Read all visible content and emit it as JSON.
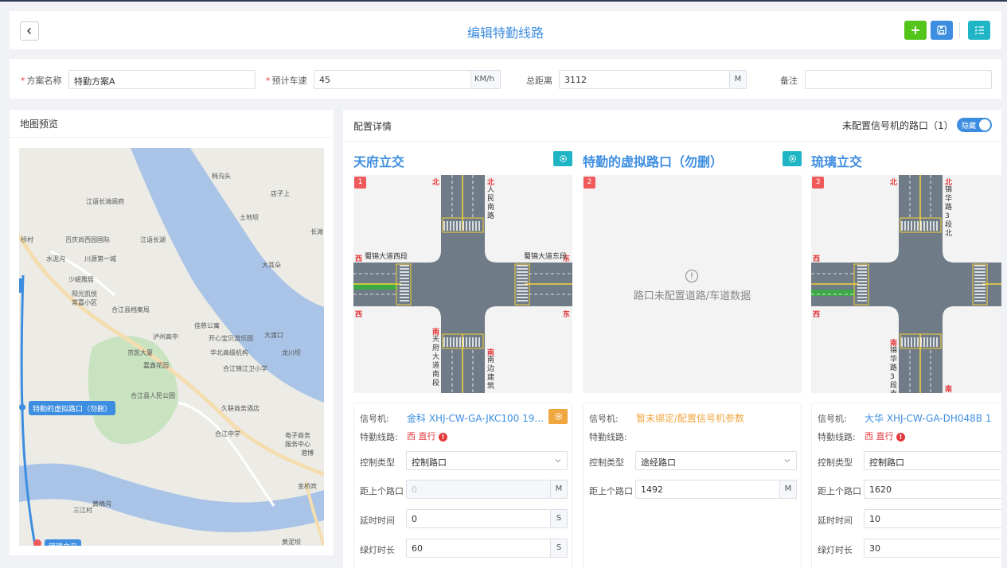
{
  "header": {
    "title": "编辑特勤线路"
  },
  "form": {
    "plan_name_label": "方案名称",
    "plan_name_value": "特勤方案A",
    "speed_label": "预计车速",
    "speed_value": "45",
    "speed_unit": "KM/h",
    "distance_label": "总距离",
    "distance_value": "3112",
    "distance_unit": "M",
    "remark_label": "备注",
    "remark_value": ""
  },
  "map": {
    "title": "地图预览",
    "labels": [
      "韩沟头",
      "店子上",
      "土地坝",
      "长滩",
      "江语长滩阆府",
      "百庆尚西园国际",
      "江语长湖",
      "水泥沟",
      "川源第一城",
      "大耳朵",
      "少岷雅居",
      "阳光凯悦\n常嘉小区",
      "合江县档案局",
      "佳慈公寓",
      "泸州高中",
      "开心宝贝游乐园",
      "大渡口",
      "京凯大厦",
      "华北高级机构",
      "龙川坝",
      "嘉鑫花园",
      "合江锦江卫小学",
      "合江县人民公园",
      "久联商务酒店",
      "合江中学",
      "电子商务\n服务中心",
      "港博",
      "金桥宾",
      "黄桷沟",
      "三江村",
      "黄泥坝",
      "桥村"
    ],
    "marker_label": "特勤的虚拟路口（勿删）",
    "marker2_label": "琉璃立交"
  },
  "config": {
    "title": "配置详情",
    "unconfigured_text": "未配置信号机的路口（1）",
    "toggle_label": "隐藏",
    "columns": [
      {
        "name": "天府立交",
        "badge": "1",
        "empty_text": "",
        "north": "北",
        "south": "南",
        "west": "西",
        "east": "东",
        "north_street": "人民南路",
        "south_street": "天府大道南段",
        "south_street2": "南边建筑",
        "west_street": "蜀锦大道西段",
        "east_street": "蜀锦大道东段",
        "info": {
          "signal_label": "信号机:",
          "signal_value": "金科 XHJ-CW-GA-JKC100 19...",
          "route_label": "特勤线路:",
          "route_value": "西 直行",
          "control_label": "控制类型",
          "control_value": "控制路口",
          "dist_label": "距上个路口",
          "dist_value": "",
          "dist_placeholder": "0",
          "dist_unit": "M",
          "delay_label": "延时时间",
          "delay_value": "0",
          "delay_unit": "S",
          "green_label": "绿灯时长",
          "green_value": "60",
          "green_unit": "S"
        }
      },
      {
        "name": "特勤的虚拟路口（勿删）",
        "badge": "2",
        "empty_text": "路口未配置道路/车道数据",
        "info": {
          "signal_label": "信号机:",
          "signal_value": "暂未绑定/配置信号机参数",
          "route_label": "特勤线路:",
          "route_value": "",
          "control_label": "控制类型",
          "control_value": "途经路口",
          "dist_label": "距上个路口",
          "dist_value": "1492",
          "dist_unit": "M"
        }
      },
      {
        "name": "琉璃立交",
        "badge": "3",
        "empty_text": "",
        "north": "北",
        "south": "南",
        "west": "西",
        "north_street": "锦华路3段北",
        "south_street": "锦华路3段南",
        "info": {
          "signal_label": "信号机:",
          "signal_value": "大华 XHJ-CW-GA-DH048B 1",
          "route_label": "特勤线路:",
          "route_value": "西 直行",
          "control_label": "控制类型",
          "control_value": "控制路口",
          "dist_label": "距上个路口",
          "dist_value": "1620",
          "delay_label": "延时时间",
          "delay_value": "10",
          "green_label": "绿灯时长",
          "green_value": "30"
        }
      }
    ]
  }
}
